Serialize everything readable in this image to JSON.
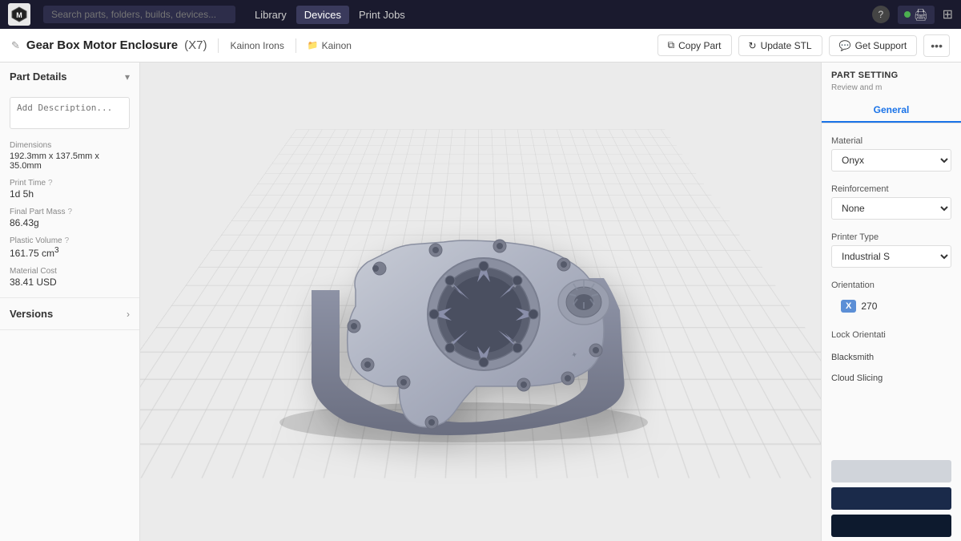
{
  "app": {
    "name": "Markforged",
    "logo_text": "M"
  },
  "nav": {
    "search_placeholder": "Search parts, folders, builds, devices...",
    "links": [
      {
        "id": "library",
        "label": "Library",
        "active": false
      },
      {
        "id": "devices",
        "label": "Devices",
        "active": true
      },
      {
        "id": "print_jobs",
        "label": "Print Jobs",
        "active": false
      }
    ]
  },
  "breadcrumb": {
    "edit_icon": "✎",
    "part_name": "Gear Box Motor Enclosure",
    "part_qty": "(X7)",
    "user": "Kainon Irons",
    "folder_icon": "📁",
    "folder": "Kainon",
    "actions": {
      "copy_part": "Copy Part",
      "update_stl": "Update STL",
      "get_support": "Get Support"
    }
  },
  "part_details": {
    "panel_title": "Part Details",
    "description_placeholder": "Add Description...",
    "dimensions_label": "Dimensions",
    "dimensions_value": "192.3mm x 137.5mm x 35.0mm",
    "print_time_label": "Print Time",
    "print_time_value": "1d 5h",
    "mass_label": "Final Part Mass",
    "mass_value": "86.43g",
    "plastic_volume_label": "Plastic Volume",
    "plastic_volume_value": "161.75 cm",
    "plastic_volume_sup": "3",
    "material_cost_label": "Material Cost",
    "material_cost_value": "38.41 USD"
  },
  "versions": {
    "label": "Versions"
  },
  "right_panel": {
    "title": "PART SETTING",
    "subtitle": "Review and m",
    "tab_general": "General",
    "material_label": "Material",
    "material_value": "Onyx",
    "reinforcement_label": "Reinforcement",
    "reinforcement_value": "None",
    "printer_type_label": "Printer Type",
    "printer_type_value": "Industrial S",
    "orientation_label": "Orientation",
    "orient_x_label": "X",
    "orient_value": "270",
    "lock_orientation_label": "Lock Orientati",
    "blacksmith_label": "Blacksmith",
    "cloud_slicing_label": "Cloud Slicing"
  }
}
